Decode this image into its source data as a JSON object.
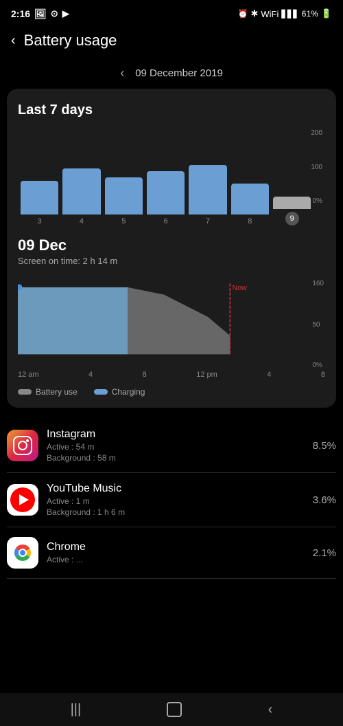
{
  "status_bar": {
    "time": "2:16",
    "battery": "61%",
    "icons_left": [
      "photo-icon",
      "location-icon",
      "youtube-icon"
    ],
    "icons_right": [
      "alarm-icon",
      "bluetooth-icon",
      "wifi-icon",
      "signal-icon",
      "battery-icon"
    ]
  },
  "header": {
    "back_label": "‹",
    "title": "Battery usage"
  },
  "date_nav": {
    "arrow": "‹",
    "date": "09 December 2019"
  },
  "chart7days": {
    "title": "Last 7 days",
    "y_labels": [
      "200",
      "100",
      "0%"
    ],
    "bars": [
      {
        "day": "3",
        "height_pct": 55,
        "active": false
      },
      {
        "day": "4",
        "height_pct": 75,
        "active": false
      },
      {
        "day": "5",
        "height_pct": 60,
        "active": false
      },
      {
        "day": "6",
        "height_pct": 70,
        "active": false
      },
      {
        "day": "7",
        "height_pct": 80,
        "active": false
      },
      {
        "day": "8",
        "height_pct": 50,
        "active": false
      },
      {
        "day": "9",
        "height_pct": 20,
        "active": true
      }
    ]
  },
  "day_detail": {
    "date": "09 Dec",
    "screen_on": "Screen on time: 2 h 14 m",
    "x_labels": [
      "12 am",
      "4",
      "8",
      "12 pm",
      "4",
      "8"
    ],
    "y_labels": [
      "160",
      "50",
      "0%"
    ],
    "legend": {
      "battery_use": "Battery use",
      "charging": "Charging"
    }
  },
  "apps": [
    {
      "name": "Instagram",
      "active": "Active : 54 m",
      "background": "Background : 58 m",
      "usage": "8.5%",
      "icon_type": "instagram"
    },
    {
      "name": "YouTube Music",
      "active": "Active : 1 m",
      "background": "Background : 1 h 6 m",
      "usage": "3.6%",
      "icon_type": "youtube"
    },
    {
      "name": "Chrome",
      "active": "Active : ...",
      "background": "",
      "usage": "2.1%",
      "icon_type": "chrome"
    }
  ],
  "bottom_nav": {
    "menu_icon": "|||",
    "home_icon": "○",
    "back_icon": "‹"
  }
}
